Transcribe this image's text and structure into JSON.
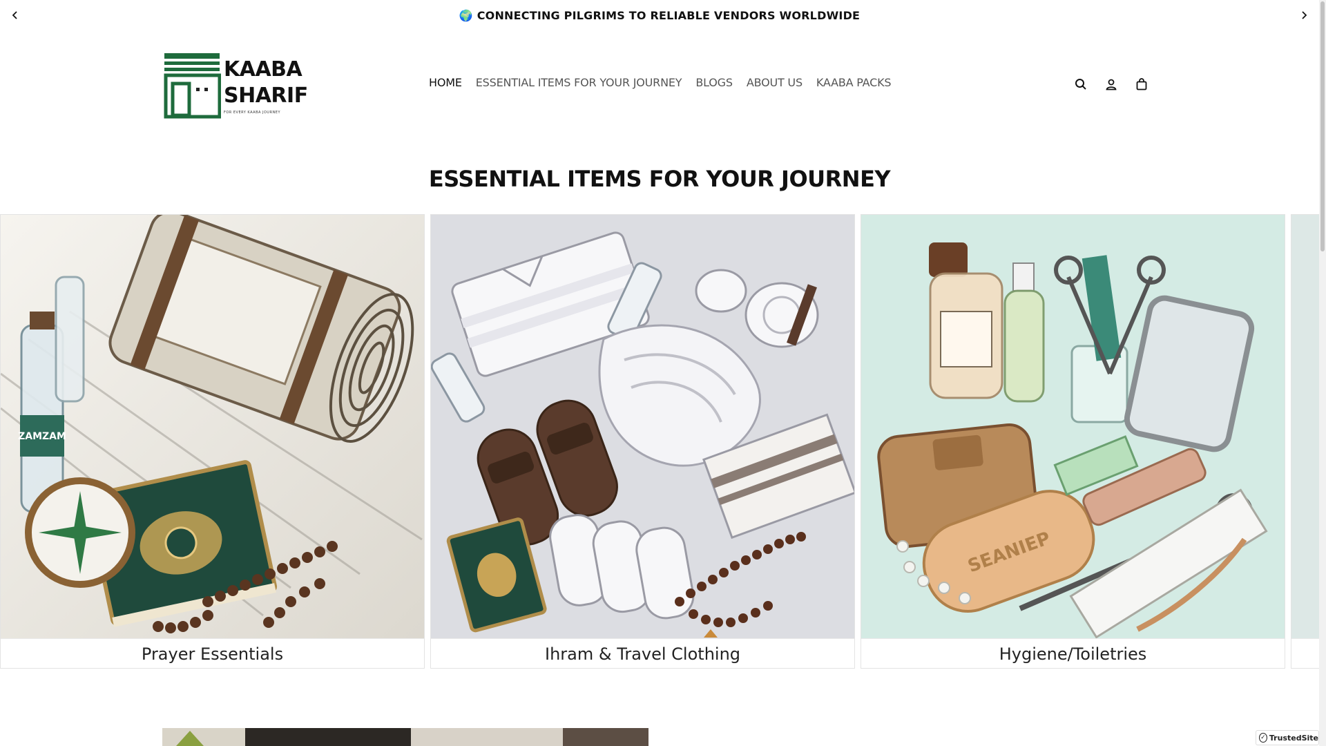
{
  "announcement": {
    "text": "🌍 CONNECTING PILGRIMS TO RELIABLE VENDORS WORLDWIDE",
    "prev_icon": "chevron-left-icon",
    "next_icon": "chevron-right-icon"
  },
  "logo": {
    "line1": "KAABA",
    "line2": "SHARIF",
    "tagline": "FOR EVERY KAABA JOURNEY",
    "brand_color": "#1e6b3c"
  },
  "nav": {
    "items": [
      {
        "label": "HOME",
        "active": true
      },
      {
        "label": "ESSENTIAL ITEMS FOR YOUR JOURNEY",
        "active": false
      },
      {
        "label": "BLOGS",
        "active": false
      },
      {
        "label": "ABOUT US",
        "active": false
      },
      {
        "label": "KAABA PACKS",
        "active": false
      }
    ]
  },
  "header_icons": [
    "search-icon",
    "account-icon",
    "cart-icon"
  ],
  "section": {
    "title": "ESSENTIAL ITEMS FOR YOUR JOURNEY"
  },
  "collections": [
    {
      "label": "Prayer Essentials",
      "bg": "#efece4"
    },
    {
      "label": "Ihram & Travel Clothing",
      "bg": "#dcdde0"
    },
    {
      "label": "Hygiene/Toiletries",
      "bg": "#d6ebe4"
    },
    {
      "label": "",
      "bg": "#dde8e6"
    }
  ],
  "trusted_badge": {
    "text": "TrustedSite"
  }
}
